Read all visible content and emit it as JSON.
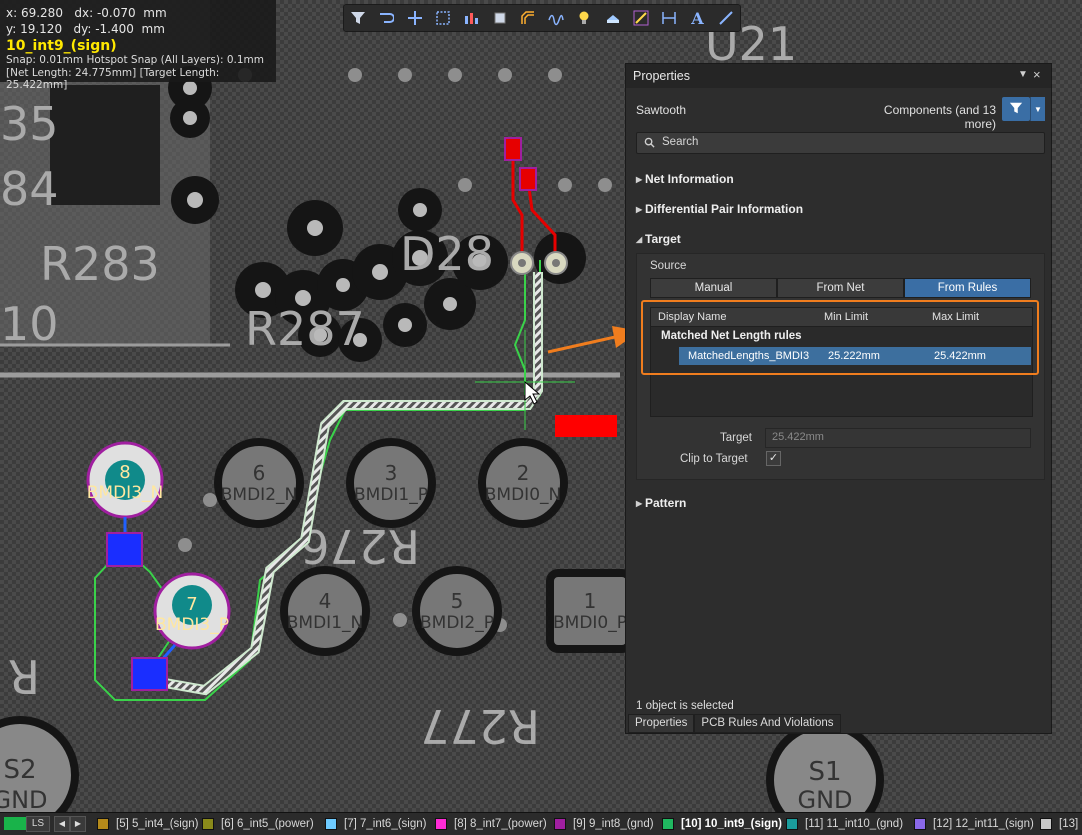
{
  "hud": {
    "line1": "x: 69.280   dx: -0.070  mm",
    "line2": "y: 19.120   dy: -1.400  mm",
    "net_name": "10_int9_(sign)",
    "snap": "Snap: 0.01mm Hotspot Snap (All Layers): 0.1mm",
    "lengths": "[Net Length: 24.775mm] [Target Length:  25.422mm]"
  },
  "toolbar": {
    "icons": [
      "filter-icon",
      "route-icon",
      "crosshair-icon",
      "select-rect-icon",
      "chart-icon",
      "chip-icon",
      "route-pair-icon",
      "tune-icon",
      "bulb-icon",
      "layer-icon",
      "length-tuning-icon",
      "dimension-icon",
      "text-icon",
      "line-icon"
    ]
  },
  "board": {
    "silk_labels": [
      "R283",
      "R287",
      "D28",
      "U21",
      "R276",
      "R277",
      "R"
    ],
    "pads": [
      {
        "num": "8",
        "net": "BMDI3_N"
      },
      {
        "num": "6",
        "net": "BMDI2_N"
      },
      {
        "num": "3",
        "net": "BMDI1_P"
      },
      {
        "num": "2",
        "net": "BMDI0_N"
      },
      {
        "num": "7",
        "net": "BMDI3_P"
      },
      {
        "num": "4",
        "net": "BMDI1_N"
      },
      {
        "num": "5",
        "net": "BMDI2_P"
      },
      {
        "num": "1",
        "net": "BMDI0_P"
      },
      {
        "num": "S2",
        "net": "GND"
      },
      {
        "num": "S1",
        "net": "GND"
      }
    ]
  },
  "panel": {
    "title": "Properties",
    "pin": "▼",
    "close": "×",
    "object_kind": "Sawtooth",
    "filter_text": "Components (and 13 more)",
    "search_placeholder": "Search",
    "sections": {
      "net_information": "Net Information",
      "diff_pair": "Differential Pair Information",
      "target": "Target",
      "pattern": "Pattern"
    },
    "source_label": "Source",
    "source_options": [
      "Manual",
      "From Net",
      "From Rules"
    ],
    "source_selected": "From Rules",
    "grid": {
      "headers": [
        "Display Name",
        "Min Limit",
        "Max Limit"
      ],
      "group": "Matched Net Length rules",
      "row": {
        "name": "MatchedLengths_BMDI3",
        "min": "25.222mm",
        "max": "25.422mm"
      }
    },
    "target_label": "Target",
    "target_value": "25.422mm",
    "clip_label": "Clip to Target",
    "clip_checked": "✓",
    "selected_text": "1 object is selected",
    "tabs": [
      "Properties",
      "PCB Rules And Violations"
    ]
  },
  "statusbar": {
    "ls": "LS",
    "layers": [
      {
        "label": "[5] 5_int4_(sign)",
        "color": "#b58a1a"
      },
      {
        "label": "[6] 6_int5_(power)",
        "color": "#8a8a1a"
      },
      {
        "label": "[7] 7_int6_(sign)",
        "color": "#6ecbff"
      },
      {
        "label": "[8] 8_int7_(power)",
        "color": "#ff2bd6"
      },
      {
        "label": "[9] 9_int8_(gnd)",
        "color": "#a01fa0"
      },
      {
        "label": "[10] 10_int9_(sign)",
        "color": "#20b860",
        "active": true
      },
      {
        "label": "[11] 11_int10_(gnd)",
        "color": "#1a9c9c"
      },
      {
        "label": "[12] 12_int11_(sign)",
        "color": "#8a68e8"
      },
      {
        "label": "[13]",
        "color": "#c8c8c8"
      }
    ]
  },
  "colors": {
    "accent": "#3a6ea5",
    "callout": "#f07d1e",
    "net_highlight": "#ffe800",
    "route_green": "#3ad24a"
  }
}
